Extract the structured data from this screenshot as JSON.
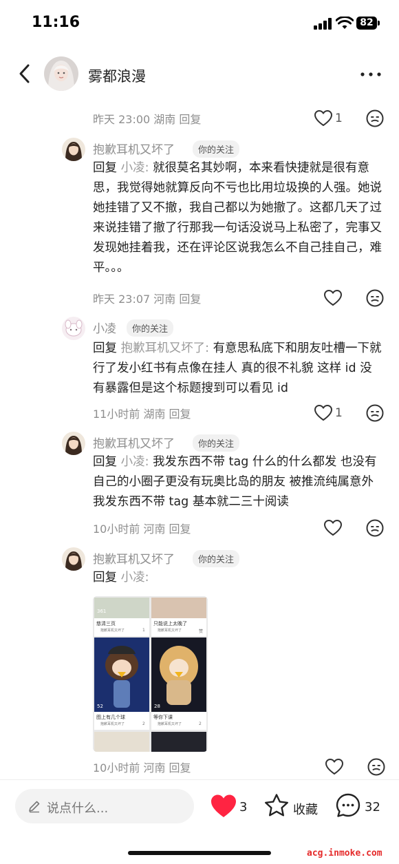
{
  "status_bar": {
    "time": "11:16",
    "battery": "82"
  },
  "header": {
    "title": "雾都浪漫"
  },
  "comments": [
    {
      "meta": "昨天 23:00 湖南 回复",
      "likes": "1"
    },
    {
      "user": "抱歉耳机又坏了",
      "badge": "你的关注",
      "reply_prefix": "回复",
      "reply_to": "小凌",
      "colon": ":",
      "text": "就很莫名其妙啊，本来看快捷就是很有意思，我觉得她就算反向不亏也比用垃圾换的人强。她说她挂错了又不撤，我自己都以为她撤了。这都几天了过来说挂错了撤了行那我一句话没说马上私密了，完事又发现她挂着我，还在评论区说我怎么不自己挂自己，难平。。。",
      "meta": "昨天 23:07 河南 回复"
    },
    {
      "user": "小凌",
      "badge": "你的关注",
      "reply_prefix": "回复",
      "reply_to": "抱歉耳机又坏了",
      "colon": ":",
      "text": "有意思私底下和朋友吐槽一下就行了发小红书有点像在挂人 真的很不礼貌 这样 id 没有暴露但是这个标题搜到可以看见 id",
      "meta": "11小时前 湖南 回复",
      "likes": "1"
    },
    {
      "user": "抱歉耳机又坏了",
      "badge": "你的关注",
      "reply_prefix": "回复",
      "reply_to": "小凌",
      "colon": ":",
      "text": "我发东西不带 tag 什么的什么都发 也没有自己的小圈子更没有玩奥比岛的朋友 被推流纯属意外 我发东西不带 tag 基本就二三十阅读",
      "meta": "10小时前 河南 回复"
    },
    {
      "user": "抱歉耳机又坏了",
      "badge": "你的关注",
      "reply_prefix": "回复",
      "reply_to": "小凌",
      "colon": ":",
      "meta": "10小时前 河南 回复",
      "thumbnail": {
        "cards": [
          {
            "views": "361",
            "caption": "慈清三页",
            "author": "抱歉耳机又坏了",
            "likes": "1"
          },
          {
            "views": "",
            "caption": "只能说上太晚了",
            "author": "抱歉耳机又坏了",
            "likes": "赞"
          },
          {
            "views": "52",
            "caption": "图上有几个球",
            "author": "抱歉耳机又坏了",
            "likes": "2"
          },
          {
            "views": "28",
            "caption": "等你下课",
            "author": "抱歉耳机又坏了",
            "likes": "2"
          }
        ]
      }
    }
  ],
  "bottom_bar": {
    "placeholder": "说点什么...",
    "likes": "3",
    "collect_label": "收藏",
    "comments": "32"
  },
  "watermark": "acg.inmoke.com",
  "colors": {
    "heart": "#ff2442",
    "meta_gray": "#8e8e8e",
    "watermark": "#e52a2a"
  }
}
